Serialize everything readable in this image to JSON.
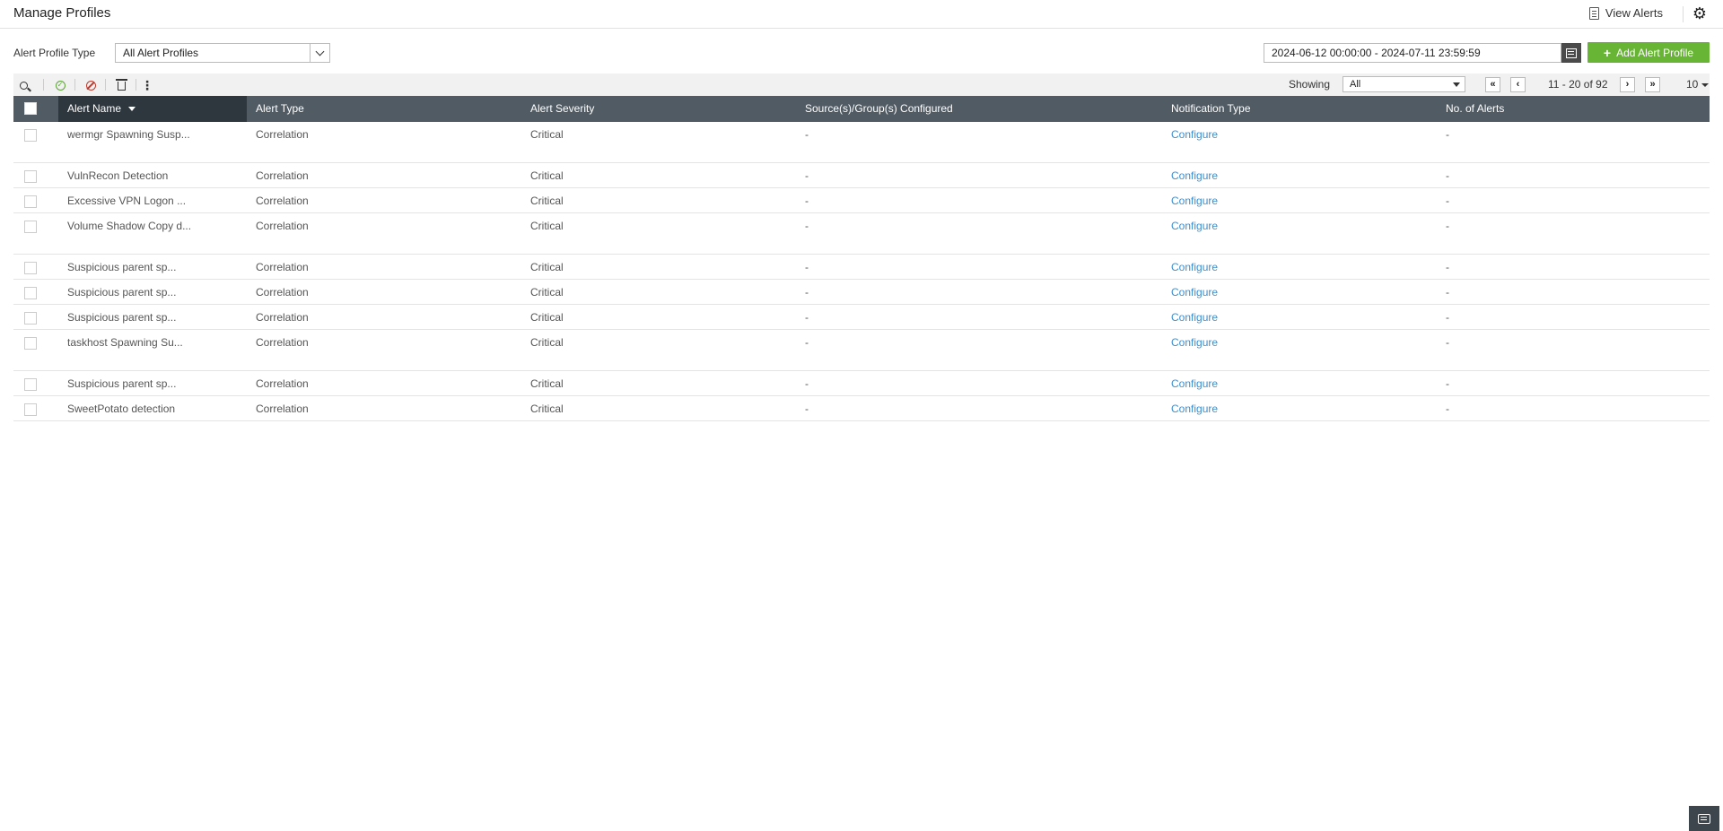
{
  "header": {
    "title": "Manage Profiles",
    "view_alerts_label": "View Alerts",
    "settings_icon": "gear-icon"
  },
  "filters": {
    "profile_type_label": "Alert Profile Type",
    "profile_type_value": "All Alert Profiles",
    "date_range": "2024-06-12 00:00:00 - 2024-07-11 23:59:59",
    "add_button_label": "Add Alert Profile"
  },
  "toolbar": {
    "showing_label": "Showing",
    "showing_value": "All",
    "page_info": "11 - 20 of 92",
    "per_page": "10",
    "first_page": "«",
    "prev_page": "‹",
    "next_page": "›",
    "last_page": "»"
  },
  "table": {
    "columns": [
      "Alert Name",
      "Alert Type",
      "Alert Severity",
      "Source(s)/Group(s) Configured",
      "Notification Type",
      "No. of Alerts"
    ],
    "rows": [
      {
        "name": "wermgr Spawning Susp...",
        "type": "Correlation",
        "severity": "Critical",
        "sources": "-",
        "notification": "Configure",
        "count": "-"
      },
      {
        "name": "VulnRecon Detection",
        "type": "Correlation",
        "severity": "Critical",
        "sources": "-",
        "notification": "Configure",
        "count": "-"
      },
      {
        "name": "Excessive VPN Logon ...",
        "type": "Correlation",
        "severity": "Critical",
        "sources": "-",
        "notification": "Configure",
        "count": "-"
      },
      {
        "name": "Volume Shadow Copy d...",
        "type": "Correlation",
        "severity": "Critical",
        "sources": "-",
        "notification": "Configure",
        "count": "-"
      },
      {
        "name": "Suspicious parent sp...",
        "type": "Correlation",
        "severity": "Critical",
        "sources": "-",
        "notification": "Configure",
        "count": "-"
      },
      {
        "name": "Suspicious parent sp...",
        "type": "Correlation",
        "severity": "Critical",
        "sources": "-",
        "notification": "Configure",
        "count": "-"
      },
      {
        "name": "Suspicious parent sp...",
        "type": "Correlation",
        "severity": "Critical",
        "sources": "-",
        "notification": "Configure",
        "count": "-"
      },
      {
        "name": "taskhost Spawning Su...",
        "type": "Correlation",
        "severity": "Critical",
        "sources": "-",
        "notification": "Configure",
        "count": "-"
      },
      {
        "name": "Suspicious parent sp...",
        "type": "Correlation",
        "severity": "Critical",
        "sources": "-",
        "notification": "Configure",
        "count": "-"
      },
      {
        "name": "SweetPotato detection",
        "type": "Correlation",
        "severity": "Critical",
        "sources": "-",
        "notification": "Configure",
        "count": "-"
      }
    ]
  },
  "colors": {
    "accent_green": "#68b536",
    "header_bg": "#515b63",
    "link": "#3a8fd1"
  }
}
